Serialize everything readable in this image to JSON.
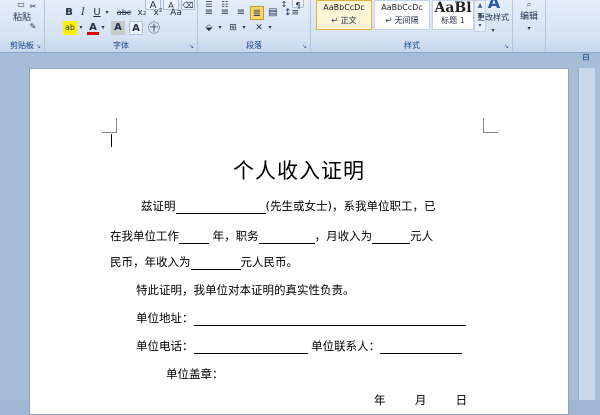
{
  "ribbon": {
    "clipboard": {
      "paste_label": "粘贴",
      "group_label": "剪贴板"
    },
    "font": {
      "group_label": "字体",
      "bold": "B",
      "italic": "I",
      "underline": "U",
      "strike": "abc",
      "subscript": "x₂",
      "superscript": "x²",
      "highlight": "ab",
      "font_color": "A",
      "char_shading": "A",
      "char_border": "A",
      "enclose": "㊉",
      "launcher": "↘"
    },
    "paragraph": {
      "group_label": "段落",
      "launcher": "↘"
    },
    "styles": {
      "group_label": "样式",
      "items": [
        {
          "preview": "AaBbCcDc",
          "name": "↵ 正文"
        },
        {
          "preview": "AaBbCcDc",
          "name": "↵ 无间隔"
        },
        {
          "preview": "AaBl",
          "name": "标题 1"
        }
      ],
      "change_styles_icon": "A",
      "change_styles_label": "更改样式",
      "launcher": "↘"
    },
    "editing": {
      "label": "编辑"
    }
  },
  "document": {
    "title": "个人收入证明",
    "line1": {
      "a": "兹证明",
      "b": "(先生或女士)，系我单位职工，已"
    },
    "line2": {
      "a": "在我单位工作",
      "b": "年，职务",
      "c": "，月收入为",
      "d": "元人"
    },
    "line3": {
      "a": "民币，年收入为",
      "b": "元人民币。"
    },
    "line4": "特此证明，我单位对本证明的真实性负责。",
    "line5": "单位地址：",
    "line6": {
      "a": "单位电话：",
      "b": "单位联系人："
    },
    "line7": "单位盖章：",
    "date": {
      "year": "年",
      "month": "月",
      "day": "日"
    }
  }
}
